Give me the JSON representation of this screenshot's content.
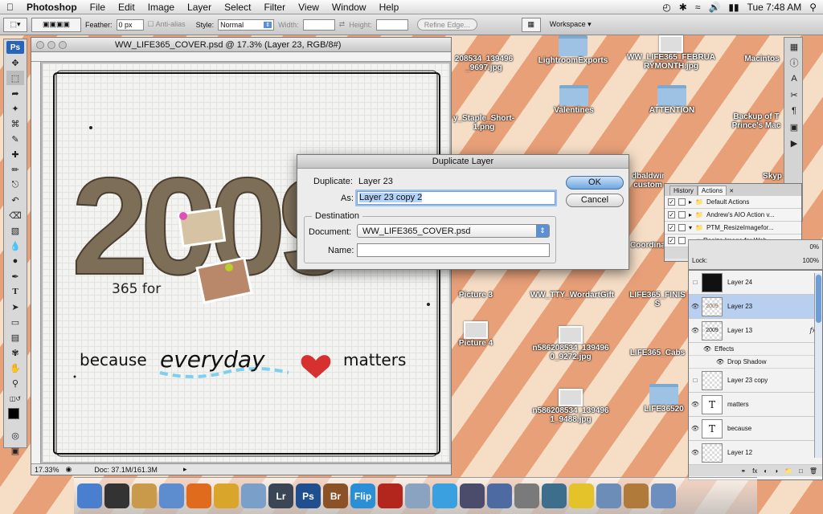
{
  "menubar": {
    "app": "Photoshop",
    "menus": [
      "File",
      "Edit",
      "Image",
      "Layer",
      "Select",
      "Filter",
      "View",
      "Window",
      "Help"
    ],
    "clock": "Tue 7:48 AM"
  },
  "options": {
    "feather_label": "Feather:",
    "feather_value": "0 px",
    "antialias": "Anti-alias",
    "style_label": "Style:",
    "style_value": "Normal",
    "width_label": "Width:",
    "height_label": "Height:",
    "refine": "Refine Edge...",
    "workspace": "Workspace"
  },
  "toolbox": {
    "logo": "Ps"
  },
  "document": {
    "title": "WW_LIFE365_COVER.psd @ 17.3% (Layer 23, RGB/8#)",
    "zoom": "17.33%",
    "doc_info": "Doc: 37.1M/161.3M",
    "art": {
      "year": "2009",
      "sub": "365 for",
      "words": [
        "because",
        "everyday",
        "matters"
      ],
      "heart_color": "#d6302f"
    }
  },
  "desktop": {
    "items": [
      {
        "label": "208534_139496\n_9697.jpg"
      },
      {
        "label": "LightroomExports"
      },
      {
        "label": "WW_LIFE365_FEBRUA\nRYMONTH.jpg"
      },
      {
        "label": "Macintos"
      },
      {
        "label": "y_Staple_Short-\n1.png"
      },
      {
        "label": "Valentines"
      },
      {
        "label": "ATTENTION"
      },
      {
        "label": "Backup of T\nPrince's Mac"
      },
      {
        "label": "dbaldwin-\ncustom"
      },
      {
        "label": "Skyp"
      },
      {
        "label": "Coordina"
      },
      {
        "label": "Picture 3"
      },
      {
        "label": "WW_TTY_WordartGift"
      },
      {
        "label": "LIFE365_FINIS\nS"
      },
      {
        "label": "Picture 4"
      },
      {
        "label": "n586208534_139496\n0_9272.jpg"
      },
      {
        "label": "LIFE365_Cabs"
      },
      {
        "label": "n586208534_139496\n1_9488.jpg"
      },
      {
        "label": "LIFE36520"
      }
    ]
  },
  "dialog": {
    "title": "Duplicate Layer",
    "duplicate_label": "Duplicate:",
    "duplicate_value": "Layer 23",
    "as_label": "As:",
    "as_value": "Layer 23 copy 2",
    "destination": "Destination",
    "document_label": "Document:",
    "document_value": "WW_LIFE365_COVER.psd",
    "name_label": "Name:",
    "name_value": "",
    "ok": "OK",
    "cancel": "Cancel"
  },
  "actions_panel": {
    "tabs": [
      "History",
      "Actions"
    ],
    "rows": [
      "Default Actions",
      "Andrew's AIO Action v...",
      "PTM_ResizeImagefor...",
      "Resize Image for Web"
    ]
  },
  "layers_panel": {
    "misc": [
      "Lock:",
      "0%",
      "100%"
    ],
    "layers": [
      {
        "name": "Layer 24",
        "visible": false,
        "thumb": ""
      },
      {
        "name": "Layer 23",
        "visible": true,
        "thumb": "2009",
        "selected": true
      },
      {
        "name": "Layer 13",
        "visible": true,
        "thumb": "2009",
        "fx": "fx"
      },
      {
        "name": "Effects",
        "sub": true
      },
      {
        "name": "Drop Shadow",
        "sub": true
      },
      {
        "name": "Layer 23 copy",
        "visible": false,
        "thumb": ""
      },
      {
        "name": "matters",
        "visible": true,
        "thumb": "T"
      },
      {
        "name": "because",
        "visible": true,
        "thumb": "T"
      },
      {
        "name": "Layer 12",
        "visible": true,
        "thumb": ""
      }
    ]
  },
  "dock": {
    "items": [
      {
        "label": "",
        "icon": "finder-icon",
        "color": "#4a7fd0"
      },
      {
        "label": "",
        "icon": "dashboard-icon",
        "color": "#333333"
      },
      {
        "label": "",
        "icon": "address-book-icon",
        "color": "#c89a4a"
      },
      {
        "label": "",
        "icon": "preview-icon",
        "color": "#5d8ccf"
      },
      {
        "label": "",
        "icon": "firefox-icon",
        "color": "#e06b1c"
      },
      {
        "label": "",
        "icon": "ichat-icon",
        "color": "#d9a52a"
      },
      {
        "label": "",
        "icon": "iphoto-icon",
        "color": "#7aa0c9"
      },
      {
        "label": "Lr",
        "icon": "lightroom-icon",
        "color": "#3a4656"
      },
      {
        "label": "Ps",
        "icon": "photoshop-icon",
        "color": "#1f4f8f"
      },
      {
        "label": "Br",
        "icon": "bridge-icon",
        "color": "#8a5226"
      },
      {
        "label": "Flip",
        "icon": "flip-icon",
        "color": "#2a8fd6"
      },
      {
        "label": "",
        "icon": "photobooth-icon",
        "color": "#b3261e"
      },
      {
        "label": "",
        "icon": "image-capture-icon",
        "color": "#8aa3c1"
      },
      {
        "label": "",
        "icon": "itunes-icon",
        "color": "#3aa0e0"
      },
      {
        "label": "",
        "icon": "imovie-icon",
        "color": "#4b4b6b"
      },
      {
        "label": "",
        "icon": "spaces-icon",
        "color": "#4d6aa3"
      },
      {
        "label": "",
        "icon": "system-prefs-icon",
        "color": "#7a7a7a"
      },
      {
        "label": "",
        "icon": "time-machine-icon",
        "color": "#3d6e8c"
      },
      {
        "label": "",
        "icon": "cyberduck-icon",
        "color": "#e3c22a"
      },
      {
        "label": "",
        "icon": "utility-icon",
        "color": "#6b8db7"
      },
      {
        "label": "",
        "icon": "presentation-icon",
        "color": "#b07a3a"
      },
      {
        "label": "",
        "icon": "photos-icon",
        "color": "#6d8fbf"
      }
    ]
  }
}
